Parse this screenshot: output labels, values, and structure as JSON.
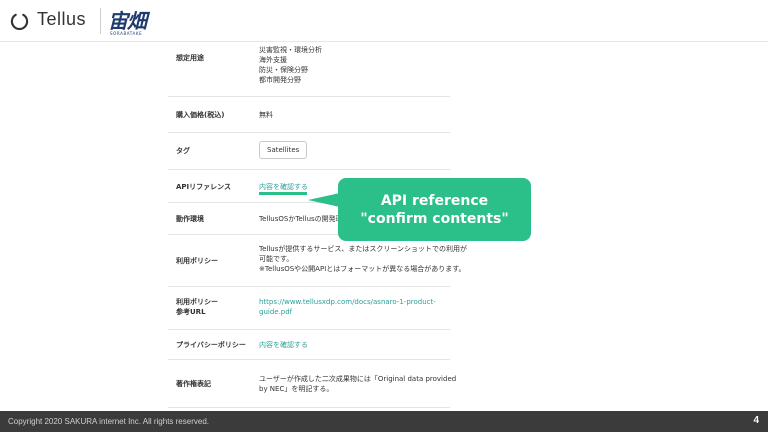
{
  "header": {
    "logo_text": "Tellus",
    "sora_mark": "宙畑",
    "sora_sub": "SORABATAKE"
  },
  "table": {
    "rows": [
      {
        "label": "想定用途",
        "lines": [
          "災害監視・環境分析",
          "海外支援",
          "防災・保険分野",
          "都市開発分野"
        ]
      },
      {
        "label": "購入価格(税込)",
        "value": "無料"
      },
      {
        "label": "タグ",
        "tag": "Satellites"
      },
      {
        "label": "APIリファレンス",
        "link": "内容を確認する"
      },
      {
        "label": "動作環境",
        "value": "TellusOSかTellusの開発環境"
      },
      {
        "label": "利用ポリシー",
        "lines": [
          "Tellusが提供するサービス、またはスクリーンショットでの利用が",
          "可能です。",
          "※TellusOSや公開APIとはフォーマットが異なる場合があります。"
        ]
      },
      {
        "label_lines": [
          "利用ポリシー",
          "参考URL"
        ],
        "link_lines": [
          "https://www.tellusxdp.com/docs/asnaro-1-product-",
          "guide.pdf"
        ]
      },
      {
        "label": "プライバシーポリシー",
        "link": "内容を確認する"
      },
      {
        "label": "著作権表記",
        "lines": [
          "ユーザーが作成した二次成果物には「Original data provided",
          "by NEC」を明記する。"
        ]
      }
    ]
  },
  "callout": {
    "line1": "API reference",
    "line2": "\"confirm contents\"",
    "color": "#2bbf8a"
  },
  "footer": {
    "copyright": "Copyright 2020 SAKURA internet Inc. All rights reserved.",
    "page_number": "4"
  }
}
